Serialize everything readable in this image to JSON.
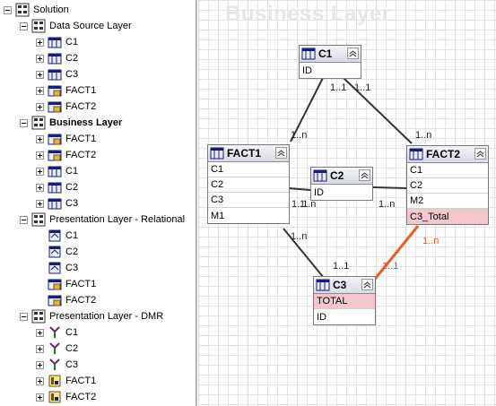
{
  "tree": {
    "root": "Solution",
    "groups": [
      {
        "label": "Data Source Layer",
        "items": [
          "C1",
          "C2",
          "C3",
          "FACT1",
          "FACT2"
        ]
      },
      {
        "label": "Business Layer",
        "items": [
          "FACT1",
          "FACT2",
          "C1",
          "C2",
          "C3"
        ]
      },
      {
        "label": "Presentation Layer - Relational",
        "items": [
          "C1",
          "C2",
          "C3",
          "FACT1",
          "FACT2"
        ]
      },
      {
        "label": "Presentation Layer - DMR",
        "items": [
          "C1",
          "C2",
          "C3",
          "FACT1",
          "FACT2"
        ]
      }
    ]
  },
  "diagram": {
    "watermark": "Business Layer",
    "tables": {
      "c1": {
        "name": "C1",
        "fields": [
          "ID"
        ]
      },
      "fact1": {
        "name": "FACT1",
        "fields": [
          "C1",
          "C2",
          "C3",
          "M1"
        ]
      },
      "c2": {
        "name": "C2",
        "fields": [
          "ID"
        ]
      },
      "fact2": {
        "name": "FACT2",
        "fields": [
          "C1",
          "C2",
          "M2",
          "C3_Total"
        ]
      },
      "c3": {
        "name": "C3",
        "fields": [
          "TOTAL",
          "ID"
        ]
      }
    },
    "cardinalities": {
      "c1_fact1_a": "1..1",
      "c1_fact2_a": "1..1",
      "fact1_c1": "1..n",
      "fact2_c1": "1..n",
      "fact1_c2": "1..1",
      "fact1_c2b": "1..n",
      "c2_fact2": "1..n",
      "fact1_c3": "1..n",
      "c3_fact1": "1..1",
      "c3_fact2": "1..1",
      "fact2_c3": "1..n"
    }
  },
  "colors": {
    "join_line": "#333333",
    "highlight_join": "#f05a22",
    "highlight_field": "#f5c6cf"
  }
}
